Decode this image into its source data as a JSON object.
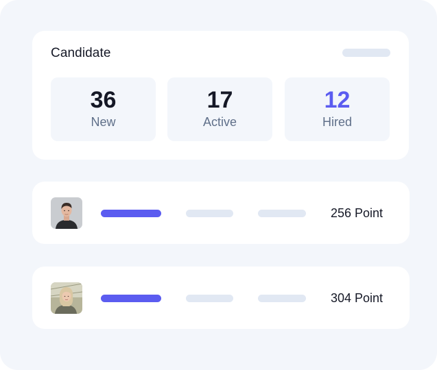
{
  "colors": {
    "accent": "#5b5cf0",
    "hired_value": "#5b5cf0",
    "text_primary": "#151826",
    "text_muted": "#5f6f89",
    "placeholder": "#e1e8f3",
    "background": "#f3f6fb"
  },
  "candidate": {
    "title": "Candidate",
    "stats": [
      {
        "value": "36",
        "label": "New"
      },
      {
        "value": "17",
        "label": "Active"
      },
      {
        "value": "12",
        "label": "Hired"
      }
    ]
  },
  "candidates": [
    {
      "avatar": "male-avatar-photo",
      "points": "256 Point"
    },
    {
      "avatar": "female-avatar-photo",
      "points": "304 Point"
    }
  ]
}
